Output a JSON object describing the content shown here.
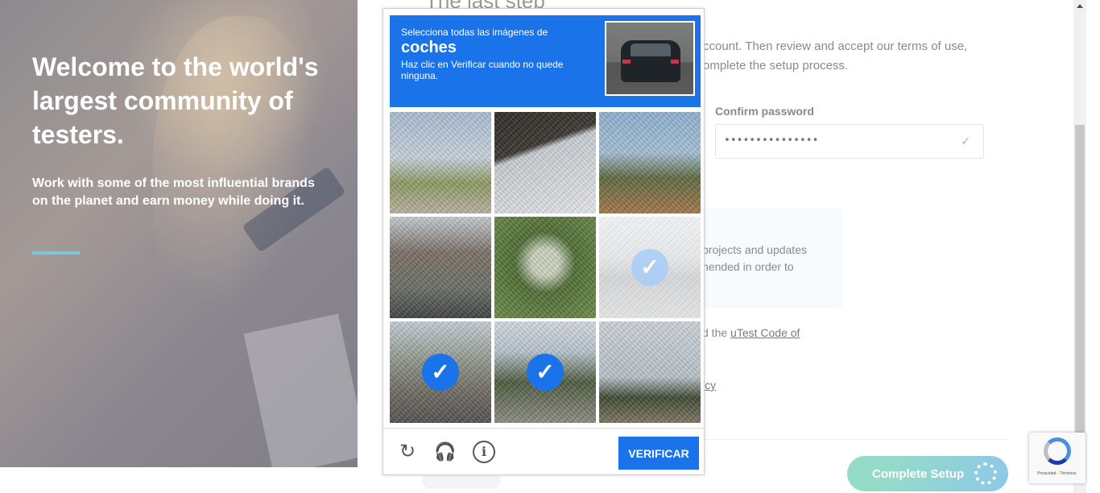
{
  "hero": {
    "title": "Welcome to the world's largest community of testers.",
    "subtitle": "Work with some of the most influential brands on the planet and earn money while doing it."
  },
  "page": {
    "title_partial": "The last step",
    "intro_partial": "ccount. Then review and accept our terms of use, omplete the setup process.",
    "confirm_password": {
      "label": "Confirm password",
      "value": "•••••••••••••••"
    },
    "info_box_partial": "projects and updates nended in order to",
    "terms_prefix": "d the ",
    "terms_link": "uTest Code of",
    "policy_partial": "icy",
    "complete_button": "Complete Setup"
  },
  "captcha": {
    "instruction_line1": "Selecciona todas las imágenes de",
    "target": "coches",
    "instruction_line3": "Haz clic en Verificar cuando no quede ninguna.",
    "verify_button": "VERIFICAR",
    "tiles": [
      {
        "selected": false
      },
      {
        "selected": false
      },
      {
        "selected": false
      },
      {
        "selected": false
      },
      {
        "selected": false
      },
      {
        "selected": true,
        "fading": true
      },
      {
        "selected": true
      },
      {
        "selected": true
      },
      {
        "selected": false
      }
    ],
    "icons": [
      "reload-icon",
      "audio-icon",
      "info-icon"
    ]
  },
  "recaptcha_badge": {
    "text": "Privacidad - Términos"
  },
  "colors": {
    "captcha_blue": "#1a73e8",
    "hero_rule": "#7cc7e0",
    "complete_green": "#94dcc7",
    "complete_blue": "#8ec9e6"
  }
}
